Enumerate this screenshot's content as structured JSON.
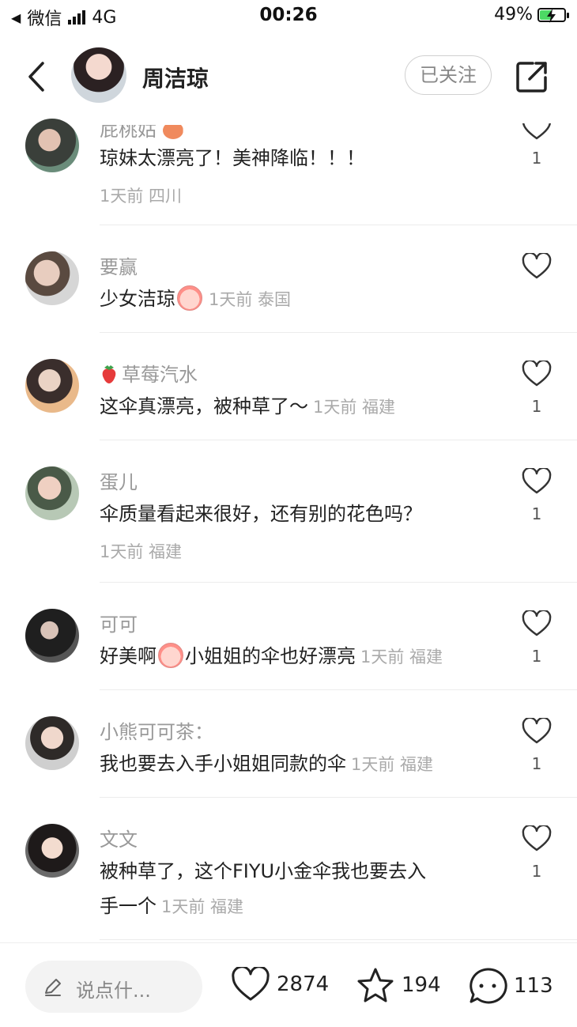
{
  "status_bar": {
    "carrier": "微信",
    "network": "4G",
    "time": "00:26",
    "battery": "49%",
    "battery_level": 0.49
  },
  "header": {
    "author_name": "周洁琼",
    "follow_label": "已关注"
  },
  "comments": [
    {
      "name": "屁桃姑",
      "text": "琼妹太漂亮了！美神降临！！！",
      "meta": "1天前 四川",
      "likes": "1"
    },
    {
      "name": "要赢",
      "text": "少女洁琼",
      "meta": "1天前 泰国",
      "likes": ""
    },
    {
      "name": "草莓汽水",
      "text": "这伞真漂亮，被种草了～",
      "meta": "1天前 福建",
      "likes": "1"
    },
    {
      "name": "蛋儿",
      "text": "伞质量看起来很好，还有别的花色吗？",
      "meta": "1天前 福建",
      "likes": "1"
    },
    {
      "name": "可可",
      "text_before": "好美啊",
      "text_after": "小姐姐的伞也好漂亮",
      "meta": "1天前 福建",
      "likes": "1"
    },
    {
      "name": "小熊可可茶：",
      "text": "我也要去入手小姐姐同款的伞",
      "meta": "1天前 福建",
      "likes": "1"
    },
    {
      "name": "文文",
      "text_line1": "被种草了，这个FIYU小金伞我也要去入",
      "text_line2": "手一个",
      "meta": "1天前 福建",
      "likes": "1"
    }
  ],
  "bottom_bar": {
    "input_placeholder": "说点什...",
    "likes": "2874",
    "favorites": "194",
    "comments": "113"
  },
  "colors": {
    "accent_green": "#4cd964",
    "text_gray": "#999999"
  }
}
